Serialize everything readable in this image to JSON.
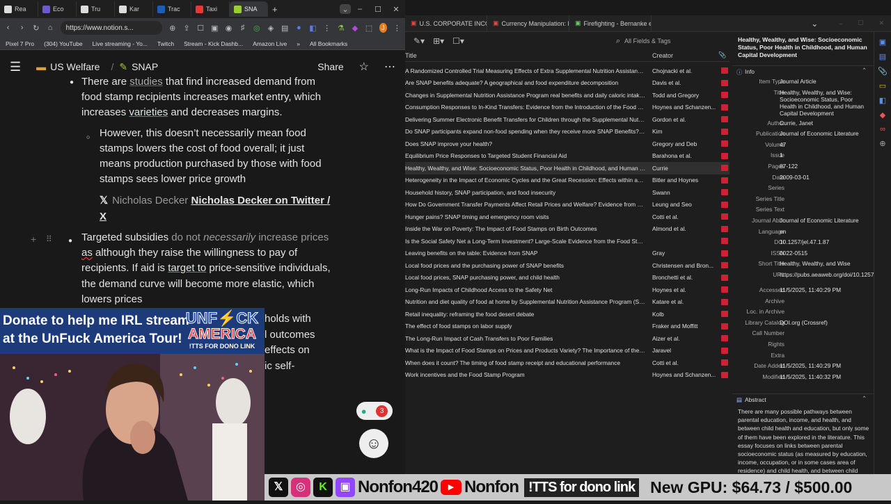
{
  "browser": {
    "tabs": [
      "Rea",
      "Eco",
      "Tru",
      "Kar",
      "Trac",
      "Taxi",
      "SNA"
    ],
    "tab_colors": [
      "#ddd",
      "#6a5acd",
      "#ddd",
      "#ddd",
      "#1a5fb4",
      "#e53935",
      "#9acd32"
    ],
    "active_tab": 6,
    "new_tab": "+",
    "url": "https://www.notion.s...",
    "bookmarks": [
      "Pixel 7 Pro",
      "(304) YouTube",
      "Live streaming - Yo...",
      "Twitch",
      "Stream - Kick Dashb...",
      "Amazon Live",
      "»",
      "All Bookmarks"
    ]
  },
  "notion": {
    "breadcrumb": [
      "US Welfare",
      "SNAP"
    ],
    "share": "Share",
    "lines": {
      "l1a": "There are ",
      "l1b": "studies",
      "l1c": " that find increased demand from",
      "l2": "food stamp recipients increases market entry, which",
      "l3a": "increases ",
      "l3b": "varieties",
      "l3c": " and decreases margins.",
      "b1": "However, this doesn’t necessarily mean food",
      "b2": "stamps lowers the cost of food overall; it just",
      "b3": "means production purchased by those with food",
      "b4": "stamps sees lower price growth",
      "tw1": "Nicholas Decker",
      "tw2": "Nicholas Decker on Twitter /",
      "tw3": "X",
      "t1a": "Targeted subsidies ",
      "t1b": "do not ",
      "t1c": "necessarily",
      "t1d": " increase prices",
      "t2a": "as",
      "t2b": " although they raise the willingness to pay of",
      "t3a": "recipients. If aid is ",
      "t3b": "target to",
      "t3c": " price-sensitive individuals,",
      "t4": "the demand curve will become more elastic, which",
      "t5": "lowers prices",
      "h1": "holds with",
      "h2": "l outcomes",
      "h3": "effects on",
      "h4": "ic self-"
    }
  },
  "overlay": {
    "donate1": "Donate to help me  IRL stream",
    "donate2": "at the UnFuck America Tour!",
    "logo1": "UNF",
    "logo1b": "CK",
    "logo2": "AMERICA",
    "logo3": "!TTS FOR DONO LINK",
    "badge": "3"
  },
  "zotero": {
    "tabs": [
      "U.S. CORPORATE INCOI",
      "Currency Manipulation: Re",
      "Firefighting - Bernanke et"
    ],
    "search_placeholder": "All Fields & Tags",
    "col_title": "Title",
    "col_creator": "Creator",
    "rows": [
      {
        "t": "A Randomized Controlled Trial Measuring Effects of Extra Supplemental Nutrition Assistance Pr...",
        "c": "Chojnacki et al."
      },
      {
        "t": "Are SNAP benefits adequate? A geographical and food expenditure decomposition",
        "c": "Davis et al."
      },
      {
        "t": "Changes in Supplemental Nutrition Assistance Program real benefits and daily caloric intake a...",
        "c": "Todd and Gregory"
      },
      {
        "t": "Consumption Responses to In-Kind Transfers: Evidence from the Introduction of the Food Sta...",
        "c": "Hoynes and Schanzen..."
      },
      {
        "t": "Delivering Summer Electronic Benefit Transfers for Children through the Supplemental Nutriti...",
        "c": "Gordon et al."
      },
      {
        "t": "Do SNAP participants expand non-food spending when they receive more SNAP Benefits?—Ev...",
        "c": "Kim"
      },
      {
        "t": "Does SNAP improve your health?",
        "c": "Gregory and Deb"
      },
      {
        "t": "Equilibrium Price Responses to Targeted Student Financial Aid",
        "c": "Barahona et al."
      },
      {
        "t": "Healthy, Wealthy, and Wise: Socioeconomic Status, Poor Health in Childhood, and Human Capi...",
        "c": "Currie"
      },
      {
        "t": "Heterogeneity in the Impact of Economic Cycles and the Great Recession: Effects within and ac...",
        "c": "Bitler and Hoynes"
      },
      {
        "t": "Household history, SNAP participation, and food insecurity",
        "c": "Swann"
      },
      {
        "t": "How Do Government Transfer Payments Affect Retail Prices and Welfare? Evidence from SNAP",
        "c": "Leung and Seo"
      },
      {
        "t": "Hunger pains? SNAP timing and emergency room visits",
        "c": "Cotti et al."
      },
      {
        "t": "Inside the War on Poverty: The Impact of Food Stamps on Birth Outcomes",
        "c": "Almond et al."
      },
      {
        "t": "Is the Social Safety Net a Long-Term Investment? Large-Scale Evidence from the Food Stamps ...",
        "c": ""
      },
      {
        "t": "Leaving benefits on the table: Evidence from SNAP",
        "c": "Gray"
      },
      {
        "t": "Local food prices and the purchasing power of SNAP benefits",
        "c": "Christensen and Bron..."
      },
      {
        "t": "Local food prices, SNAP purchasing power, and child health",
        "c": "Bronchetti et al."
      },
      {
        "t": "Long-Run Impacts of Childhood Access to the Safety Net",
        "c": "Hoynes et al."
      },
      {
        "t": "Nutrition and diet quality of food at home by Supplemental Nutrition Assistance Program (SN...",
        "c": "Katare et al."
      },
      {
        "t": "Retail inequality: reframing the food desert debate",
        "c": "Kolb"
      },
      {
        "t": "The effect of food stamps on labor supply",
        "c": "Fraker and Moffitt"
      },
      {
        "t": "The Long-Run Impact of Cash Transfers to Poor Families",
        "c": "Aizer et al."
      },
      {
        "t": "What is the Impact of Food Stamps on Prices and Products Variety? The Importance of the Sup...",
        "c": "Jaravel"
      },
      {
        "t": "When does it count? The timing of food stamp receipt and educational performance",
        "c": "Cotti et al."
      },
      {
        "t": "Work incentives and the Food Stamp Program",
        "c": "Hoynes and Schanzen..."
      }
    ],
    "selected_row": 8,
    "item": {
      "header": "Healthy, Wealthy, and Wise: Socioeconomic Status, Poor Health in Childhood, and Human Capital Development",
      "info": "Info",
      "fields": [
        [
          "Item Type",
          "Journal Article"
        ],
        [
          "Title",
          "Healthy, Wealthy, and Wise: Socioeconomic Status, Poor Health in Childhood, and Human Capital Development"
        ],
        [
          "Author",
          "Currie, Janet"
        ],
        [
          "Publication",
          "Journal of Economic Literature"
        ],
        [
          "Volume",
          "47"
        ],
        [
          "Issue",
          "1"
        ],
        [
          "Pages",
          "87-122"
        ],
        [
          "Date",
          "2009-03-01"
        ],
        [
          "Series",
          ""
        ],
        [
          "Series Title",
          ""
        ],
        [
          "Series Text",
          ""
        ],
        [
          "Journal Abbr",
          "Journal of Economic Literature"
        ],
        [
          "Language",
          "en"
        ],
        [
          "DOI",
          "10.1257/jel.47.1.87"
        ],
        [
          "ISSN",
          "0022-0515"
        ],
        [
          "Short Title",
          "Healthy, Wealthy, and Wise"
        ],
        [
          "URL",
          "https://pubs.aeaweb.org/doi/10.1257/jel.47.1.87"
        ],
        [
          "Accessed",
          "11/5/2025, 11:40:29 PM"
        ],
        [
          "Archive",
          ""
        ],
        [
          "Loc. in Archive",
          ""
        ],
        [
          "Library Catalog",
          "DOI.org (Crossref)"
        ],
        [
          "Call Number",
          ""
        ],
        [
          "Rights",
          ""
        ],
        [
          "Extra",
          ""
        ],
        [
          "Date Added",
          "11/5/2025, 11:40:29 PM"
        ],
        [
          "Modified",
          "11/5/2025, 11:40:32 PM"
        ]
      ],
      "abstract_label": "Abstract",
      "abstract": "There are many possible pathways between parental education, income, and health, and between child health and education, but only some of them have been explored in the literature. This essay focuses on links between parental socioeconomic status (as measured by education, income, occupation, or in some cases area of residence) and child health, and between child"
    }
  },
  "ticker": {
    "handle1": "Nonfon420",
    "handle2": "Nonfon",
    "tts": "!TTS for dono link",
    "goal": "New GPU: $64.73 / $500.00"
  }
}
